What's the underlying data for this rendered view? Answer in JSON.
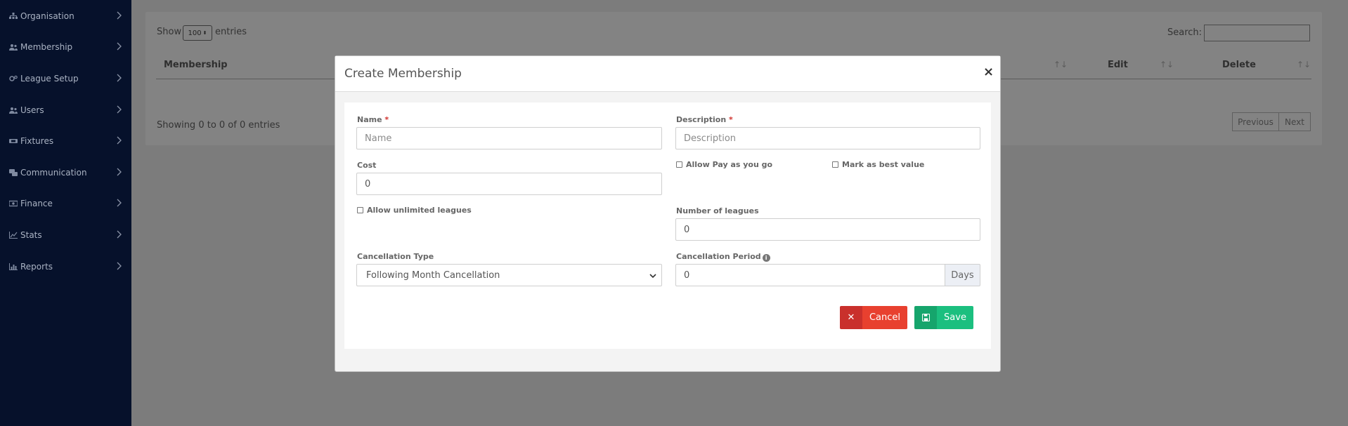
{
  "sidebar": {
    "items": [
      {
        "label": "Organisation",
        "icon": "sitemap-icon"
      },
      {
        "label": "Membership",
        "icon": "users-icon"
      },
      {
        "label": "League Setup",
        "icon": "cogs-icon"
      },
      {
        "label": "Users",
        "icon": "users-icon"
      },
      {
        "label": "Fixtures",
        "icon": "ticket-icon"
      },
      {
        "label": "Communication",
        "icon": "comments-icon"
      },
      {
        "label": "Finance",
        "icon": "money-icon"
      },
      {
        "label": "Stats",
        "icon": "line-chart-icon"
      },
      {
        "label": "Reports",
        "icon": "bar-chart-icon"
      }
    ]
  },
  "table": {
    "show_label": "Show",
    "page_size": "100",
    "entries_label": "entries",
    "search_label": "Search:",
    "columns": [
      "Membership",
      "Edit",
      "Delete"
    ],
    "info": "Showing 0 to 0 of 0 entries",
    "previous": "Previous",
    "next": "Next"
  },
  "modal": {
    "title": "Create Membership",
    "close": "×",
    "name": {
      "label": "Name",
      "required": "*",
      "placeholder": "Name"
    },
    "description": {
      "label": "Description",
      "required": "*",
      "placeholder": "Description"
    },
    "cost": {
      "label": "Cost",
      "value": "0"
    },
    "allow_payg": "Allow Pay as you go",
    "best_value": "Mark as best value",
    "unlimited_leagues": "Allow unlimited leagues",
    "number_of_leagues": {
      "label": "Number of leagues",
      "value": "0"
    },
    "cancellation_type": {
      "label": "Cancellation Type",
      "value": "Following Month Cancellation"
    },
    "cancellation_period": {
      "label": "Cancellation Period",
      "value": "0",
      "addon": "Days"
    },
    "cancel": "Cancel",
    "save": "Save"
  }
}
